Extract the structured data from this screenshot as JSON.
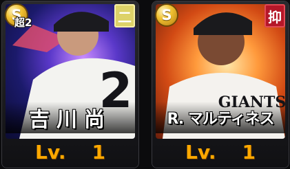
{
  "cards": [
    {
      "rank": "S",
      "boost": "超2",
      "position": "二",
      "name": "吉川尚",
      "level_label": "Lv.",
      "level_value": "1",
      "uniform_number": "2"
    },
    {
      "rank": "S",
      "boost": "",
      "position": "抑",
      "name": "R. マルティネス",
      "level_label": "Lv.",
      "level_value": "1",
      "jersey_text": "GIANTS"
    }
  ],
  "icons": {
    "rank_badge": "gold-s-medal-icon",
    "position_badge": "position-kanji-badge-icon"
  }
}
